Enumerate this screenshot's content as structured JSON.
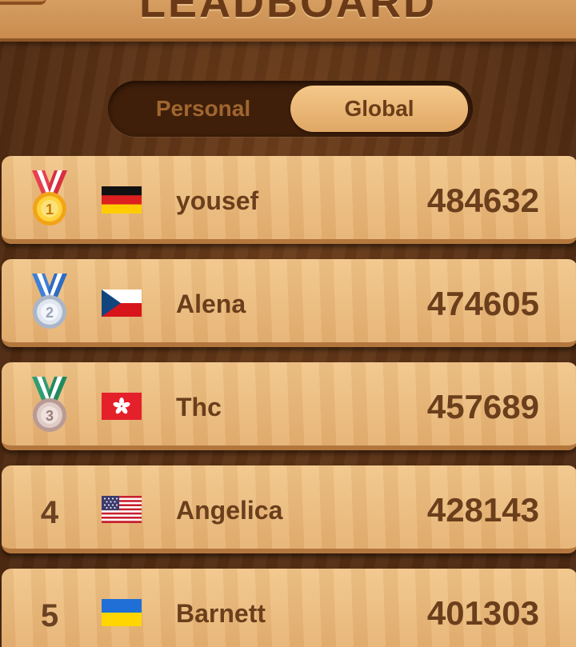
{
  "header": {
    "title": "LEADBOARD"
  },
  "toggle": {
    "personal_label": "Personal",
    "global_label": "Global",
    "selected": "Global"
  },
  "rows": [
    {
      "rank": "1",
      "medal": "gold-medal-icon",
      "flag": "germany-flag-icon",
      "name": "yousef",
      "score": "484632"
    },
    {
      "rank": "2",
      "medal": "silver-medal-icon",
      "flag": "czech-flag-icon",
      "name": "Alena",
      "score": "474605"
    },
    {
      "rank": "3",
      "medal": "bronze-medal-icon",
      "flag": "hong-kong-flag-icon",
      "name": "Thc",
      "score": "457689"
    },
    {
      "rank": "4",
      "flag": "usa-flag-icon",
      "name": "Angelica",
      "score": "428143"
    },
    {
      "rank": "5",
      "flag": "ukraine-flag-icon",
      "name": "Barnett",
      "score": "401303"
    }
  ],
  "colors": {
    "wood_light": "#f1c68b",
    "wood_dark": "#b3773d",
    "text_brown": "#6b3e1c",
    "background": "#5a3116"
  }
}
